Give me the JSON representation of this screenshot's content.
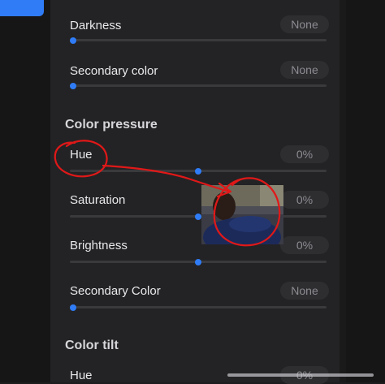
{
  "sections": {
    "color_pressure": "Color pressure",
    "color_tilt": "Color tilt"
  },
  "rows": {
    "darkness": {
      "label": "Darkness",
      "value": "None",
      "level": 0
    },
    "secondary_color": {
      "label": "Secondary color",
      "value": "None",
      "level": 0
    },
    "hue": {
      "label": "Hue",
      "value": "0%",
      "level": 0.5
    },
    "saturation": {
      "label": "Saturation",
      "value": "0%",
      "level": 0.5
    },
    "brightness": {
      "label": "Brightness",
      "value": "0%",
      "level": 0.5
    },
    "secondary_color_2": {
      "label": "Secondary Color",
      "value": "None",
      "level": 0
    },
    "tilt_hue": {
      "label": "Hue",
      "value": "0%"
    }
  },
  "colors": {
    "accent": "#2f7cf6",
    "annotation": "#e01818"
  }
}
